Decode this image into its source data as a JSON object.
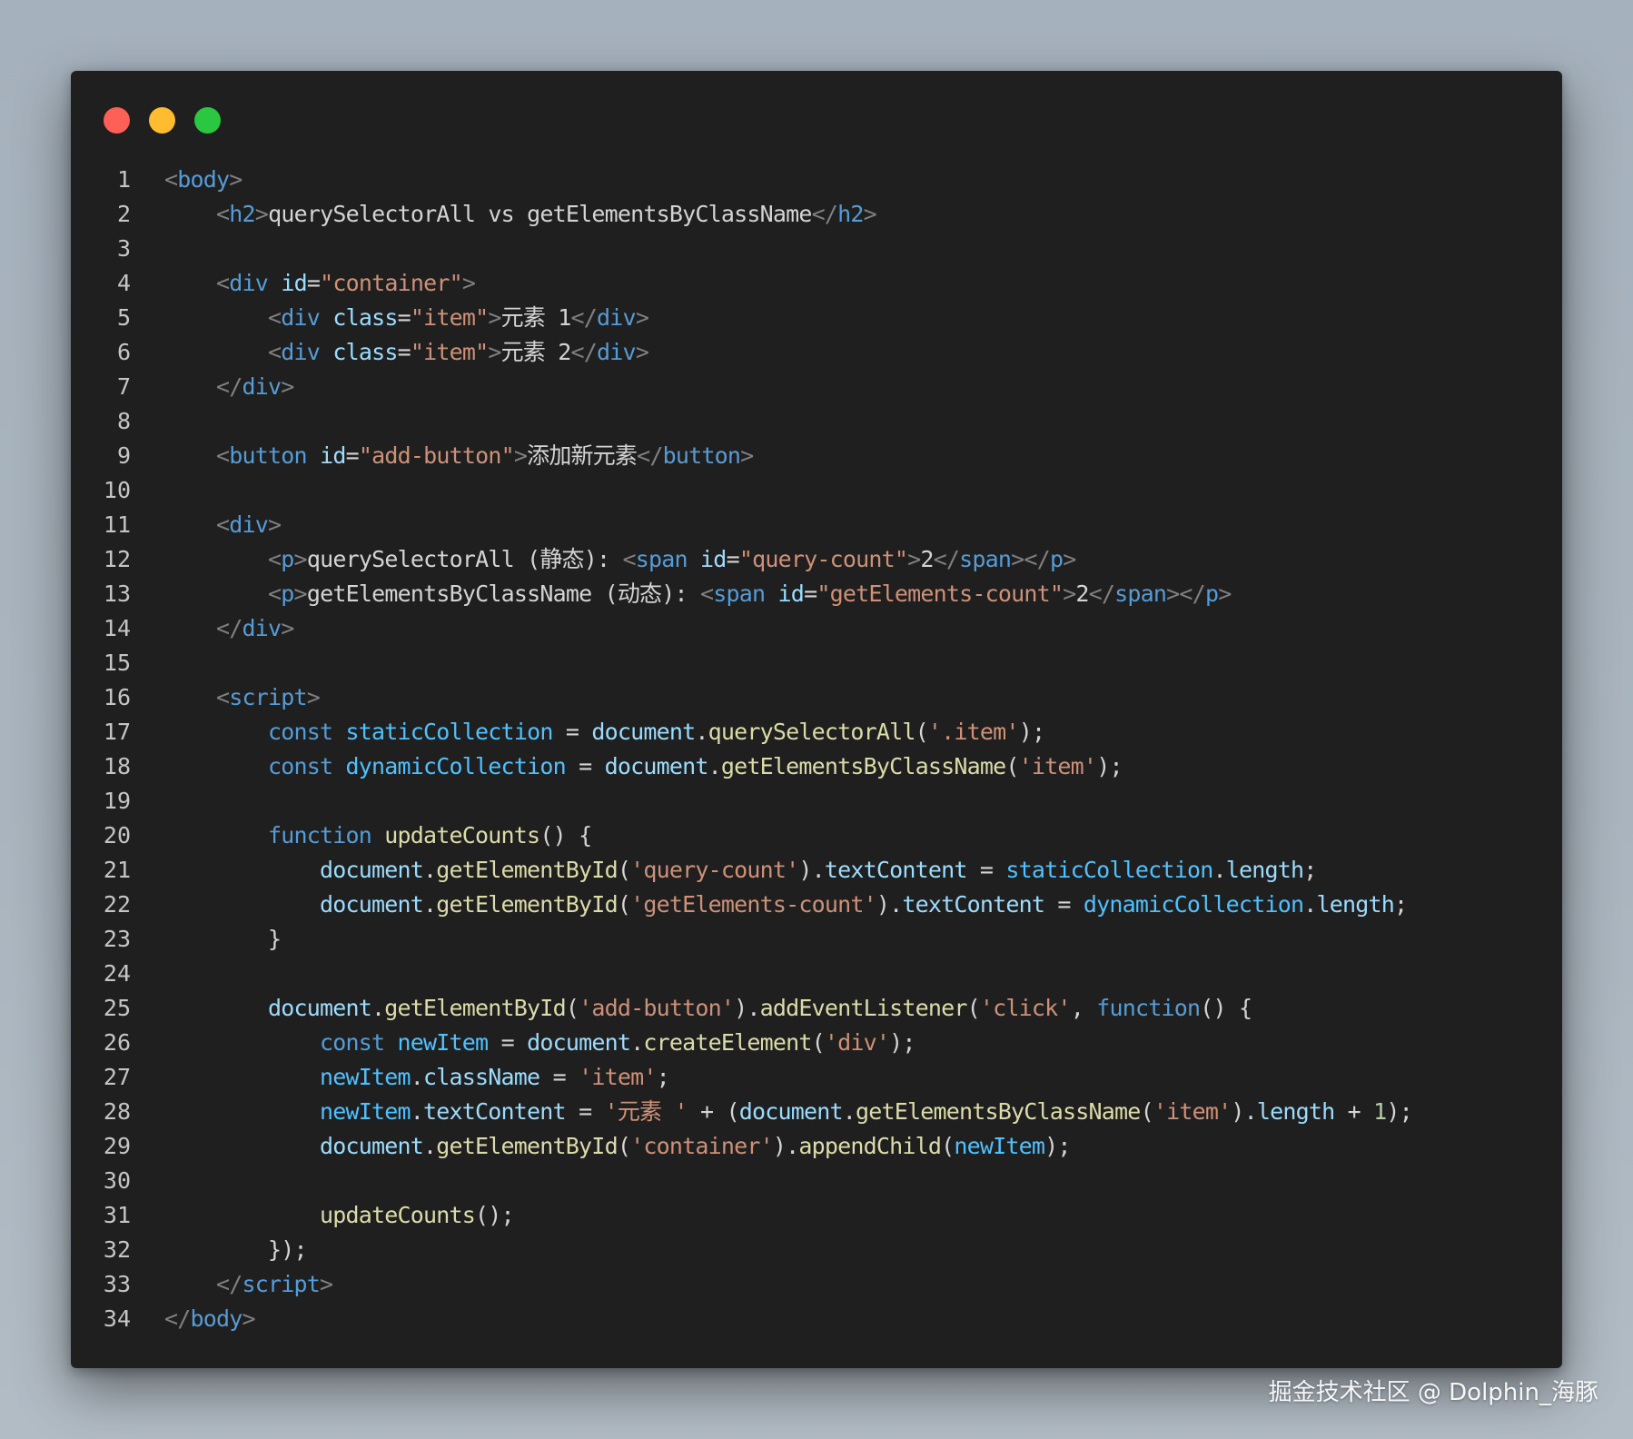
{
  "window": {
    "controls": [
      "close",
      "minimize",
      "maximize"
    ],
    "colors": {
      "background": "#1f1f1f",
      "close": "#fe5f57",
      "minimize": "#febc2e",
      "maximize": "#29c840"
    }
  },
  "code": {
    "language": "html",
    "line_numbers": [
      "1",
      "2",
      "3",
      "4",
      "5",
      "6",
      "7",
      "8",
      "9",
      "10",
      "11",
      "12",
      "13",
      "14",
      "15",
      "16",
      "17",
      "18",
      "19",
      "20",
      "21",
      "22",
      "23",
      "24",
      "25",
      "26",
      "27",
      "28",
      "29",
      "30",
      "31",
      "32",
      "33",
      "34"
    ],
    "lines": [
      [
        [
          "punc",
          "<"
        ],
        [
          "tag",
          "body"
        ],
        [
          "punc",
          ">"
        ]
      ],
      [
        [
          "text",
          "    "
        ],
        [
          "punc",
          "<"
        ],
        [
          "tag",
          "h2"
        ],
        [
          "punc",
          ">"
        ],
        [
          "text",
          "querySelectorAll vs getElementsByClassName"
        ],
        [
          "punc",
          "</"
        ],
        [
          "tag",
          "h2"
        ],
        [
          "punc",
          ">"
        ]
      ],
      [],
      [
        [
          "text",
          "    "
        ],
        [
          "punc",
          "<"
        ],
        [
          "tag",
          "div"
        ],
        [
          "text",
          " "
        ],
        [
          "attr",
          "id"
        ],
        [
          "op",
          "="
        ],
        [
          "str",
          "\"container\""
        ],
        [
          "punc",
          ">"
        ]
      ],
      [
        [
          "text",
          "        "
        ],
        [
          "punc",
          "<"
        ],
        [
          "tag",
          "div"
        ],
        [
          "text",
          " "
        ],
        [
          "attr",
          "class"
        ],
        [
          "op",
          "="
        ],
        [
          "str",
          "\"item\""
        ],
        [
          "punc",
          ">"
        ],
        [
          "text",
          "元素 1"
        ],
        [
          "punc",
          "</"
        ],
        [
          "tag",
          "div"
        ],
        [
          "punc",
          ">"
        ]
      ],
      [
        [
          "text",
          "        "
        ],
        [
          "punc",
          "<"
        ],
        [
          "tag",
          "div"
        ],
        [
          "text",
          " "
        ],
        [
          "attr",
          "class"
        ],
        [
          "op",
          "="
        ],
        [
          "str",
          "\"item\""
        ],
        [
          "punc",
          ">"
        ],
        [
          "text",
          "元素 2"
        ],
        [
          "punc",
          "</"
        ],
        [
          "tag",
          "div"
        ],
        [
          "punc",
          ">"
        ]
      ],
      [
        [
          "text",
          "    "
        ],
        [
          "punc",
          "</"
        ],
        [
          "tag",
          "div"
        ],
        [
          "punc",
          ">"
        ]
      ],
      [],
      [
        [
          "text",
          "    "
        ],
        [
          "punc",
          "<"
        ],
        [
          "tag",
          "button"
        ],
        [
          "text",
          " "
        ],
        [
          "attr",
          "id"
        ],
        [
          "op",
          "="
        ],
        [
          "str",
          "\"add-button\""
        ],
        [
          "punc",
          ">"
        ],
        [
          "text",
          "添加新元素"
        ],
        [
          "punc",
          "</"
        ],
        [
          "tag",
          "button"
        ],
        [
          "punc",
          ">"
        ]
      ],
      [],
      [
        [
          "text",
          "    "
        ],
        [
          "punc",
          "<"
        ],
        [
          "tag",
          "div"
        ],
        [
          "punc",
          ">"
        ]
      ],
      [
        [
          "text",
          "        "
        ],
        [
          "punc",
          "<"
        ],
        [
          "tag",
          "p"
        ],
        [
          "punc",
          ">"
        ],
        [
          "text",
          "querySelectorAll (静态): "
        ],
        [
          "punc",
          "<"
        ],
        [
          "tag",
          "span"
        ],
        [
          "text",
          " "
        ],
        [
          "attr",
          "id"
        ],
        [
          "op",
          "="
        ],
        [
          "str",
          "\"query-count\""
        ],
        [
          "punc",
          ">"
        ],
        [
          "text",
          "2"
        ],
        [
          "punc",
          "</"
        ],
        [
          "tag",
          "span"
        ],
        [
          "punc",
          "></"
        ],
        [
          "tag",
          "p"
        ],
        [
          "punc",
          ">"
        ]
      ],
      [
        [
          "text",
          "        "
        ],
        [
          "punc",
          "<"
        ],
        [
          "tag",
          "p"
        ],
        [
          "punc",
          ">"
        ],
        [
          "text",
          "getElementsByClassName (动态): "
        ],
        [
          "punc",
          "<"
        ],
        [
          "tag",
          "span"
        ],
        [
          "text",
          " "
        ],
        [
          "attr",
          "id"
        ],
        [
          "op",
          "="
        ],
        [
          "str",
          "\"getElements-count\""
        ],
        [
          "punc",
          ">"
        ],
        [
          "text",
          "2"
        ],
        [
          "punc",
          "</"
        ],
        [
          "tag",
          "span"
        ],
        [
          "punc",
          "></"
        ],
        [
          "tag",
          "p"
        ],
        [
          "punc",
          ">"
        ]
      ],
      [
        [
          "text",
          "    "
        ],
        [
          "punc",
          "</"
        ],
        [
          "tag",
          "div"
        ],
        [
          "punc",
          ">"
        ]
      ],
      [],
      [
        [
          "text",
          "    "
        ],
        [
          "punc",
          "<"
        ],
        [
          "tag",
          "script"
        ],
        [
          "punc",
          ">"
        ]
      ],
      [
        [
          "text",
          "        "
        ],
        [
          "kw",
          "const"
        ],
        [
          "text",
          " "
        ],
        [
          "var",
          "staticCollection"
        ],
        [
          "op",
          " = "
        ],
        [
          "prop",
          "document"
        ],
        [
          "op",
          "."
        ],
        [
          "fn",
          "querySelectorAll"
        ],
        [
          "op",
          "("
        ],
        [
          "str",
          "'.item'"
        ],
        [
          "op",
          ");"
        ]
      ],
      [
        [
          "text",
          "        "
        ],
        [
          "kw",
          "const"
        ],
        [
          "text",
          " "
        ],
        [
          "var",
          "dynamicCollection"
        ],
        [
          "op",
          " = "
        ],
        [
          "prop",
          "document"
        ],
        [
          "op",
          "."
        ],
        [
          "fn",
          "getElementsByClassName"
        ],
        [
          "op",
          "("
        ],
        [
          "str",
          "'item'"
        ],
        [
          "op",
          ");"
        ]
      ],
      [],
      [
        [
          "text",
          "        "
        ],
        [
          "kw",
          "function"
        ],
        [
          "text",
          " "
        ],
        [
          "fn",
          "updateCounts"
        ],
        [
          "op",
          "() {"
        ]
      ],
      [
        [
          "text",
          "            "
        ],
        [
          "prop",
          "document"
        ],
        [
          "op",
          "."
        ],
        [
          "fn",
          "getElementById"
        ],
        [
          "op",
          "("
        ],
        [
          "str",
          "'query-count'"
        ],
        [
          "op",
          ")."
        ],
        [
          "prop",
          "textContent"
        ],
        [
          "op",
          " = "
        ],
        [
          "var",
          "staticCollection"
        ],
        [
          "op",
          "."
        ],
        [
          "prop",
          "length"
        ],
        [
          "op",
          ";"
        ]
      ],
      [
        [
          "text",
          "            "
        ],
        [
          "prop",
          "document"
        ],
        [
          "op",
          "."
        ],
        [
          "fn",
          "getElementById"
        ],
        [
          "op",
          "("
        ],
        [
          "str",
          "'getElements-count'"
        ],
        [
          "op",
          ")."
        ],
        [
          "prop",
          "textContent"
        ],
        [
          "op",
          " = "
        ],
        [
          "var",
          "dynamicCollection"
        ],
        [
          "op",
          "."
        ],
        [
          "prop",
          "length"
        ],
        [
          "op",
          ";"
        ]
      ],
      [
        [
          "text",
          "        "
        ],
        [
          "op",
          "}"
        ]
      ],
      [],
      [
        [
          "text",
          "        "
        ],
        [
          "prop",
          "document"
        ],
        [
          "op",
          "."
        ],
        [
          "fn",
          "getElementById"
        ],
        [
          "op",
          "("
        ],
        [
          "str",
          "'add-button'"
        ],
        [
          "op",
          ")."
        ],
        [
          "fn",
          "addEventListener"
        ],
        [
          "op",
          "("
        ],
        [
          "str",
          "'click'"
        ],
        [
          "op",
          ", "
        ],
        [
          "kw",
          "function"
        ],
        [
          "op",
          "() {"
        ]
      ],
      [
        [
          "text",
          "            "
        ],
        [
          "kw",
          "const"
        ],
        [
          "text",
          " "
        ],
        [
          "var",
          "newItem"
        ],
        [
          "op",
          " = "
        ],
        [
          "prop",
          "document"
        ],
        [
          "op",
          "."
        ],
        [
          "fn",
          "createElement"
        ],
        [
          "op",
          "("
        ],
        [
          "str",
          "'div'"
        ],
        [
          "op",
          ");"
        ]
      ],
      [
        [
          "text",
          "            "
        ],
        [
          "var",
          "newItem"
        ],
        [
          "op",
          "."
        ],
        [
          "prop",
          "className"
        ],
        [
          "op",
          " = "
        ],
        [
          "str",
          "'item'"
        ],
        [
          "op",
          ";"
        ]
      ],
      [
        [
          "text",
          "            "
        ],
        [
          "var",
          "newItem"
        ],
        [
          "op",
          "."
        ],
        [
          "prop",
          "textContent"
        ],
        [
          "op",
          " = "
        ],
        [
          "str",
          "'元素 '"
        ],
        [
          "op",
          " + ("
        ],
        [
          "prop",
          "document"
        ],
        [
          "op",
          "."
        ],
        [
          "fn",
          "getElementsByClassName"
        ],
        [
          "op",
          "("
        ],
        [
          "str",
          "'item'"
        ],
        [
          "op",
          ")."
        ],
        [
          "prop",
          "length"
        ],
        [
          "op",
          " + "
        ],
        [
          "num",
          "1"
        ],
        [
          "op",
          ");"
        ]
      ],
      [
        [
          "text",
          "            "
        ],
        [
          "prop",
          "document"
        ],
        [
          "op",
          "."
        ],
        [
          "fn",
          "getElementById"
        ],
        [
          "op",
          "("
        ],
        [
          "str",
          "'container'"
        ],
        [
          "op",
          ")."
        ],
        [
          "fn",
          "appendChild"
        ],
        [
          "op",
          "("
        ],
        [
          "var",
          "newItem"
        ],
        [
          "op",
          ");"
        ]
      ],
      [],
      [
        [
          "text",
          "            "
        ],
        [
          "fn",
          "updateCounts"
        ],
        [
          "op",
          "();"
        ]
      ],
      [
        [
          "text",
          "        "
        ],
        [
          "op",
          "});"
        ]
      ],
      [
        [
          "text",
          "    "
        ],
        [
          "punc",
          "</"
        ],
        [
          "tag",
          "script"
        ],
        [
          "punc",
          ">"
        ]
      ],
      [
        [
          "punc",
          "</"
        ],
        [
          "tag",
          "body"
        ],
        [
          "punc",
          ">"
        ]
      ]
    ]
  },
  "watermark": {
    "text": "掘金技术社区 @ Dolphin_海豚"
  }
}
